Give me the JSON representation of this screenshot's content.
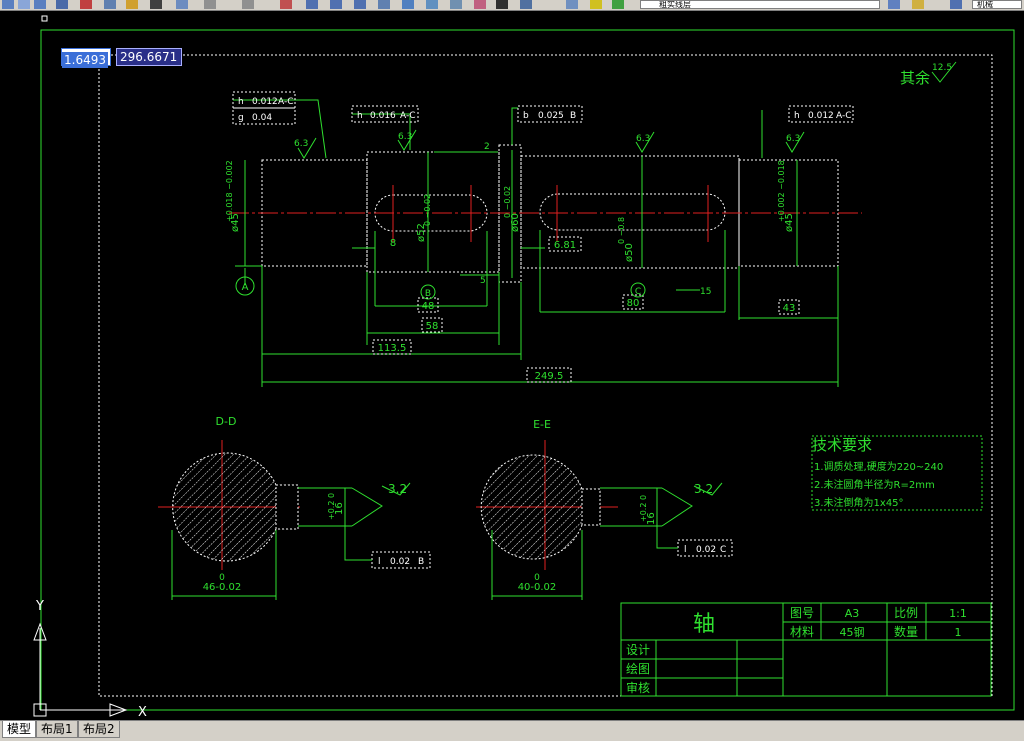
{
  "toolbar": {
    "layer_name": "粗实线层",
    "style_name": "机械"
  },
  "coordinate_input": {
    "x_value": "1.6493",
    "y_value": "296.6671"
  },
  "drawing": {
    "title": "轴",
    "surface_rest": "其余",
    "roughness_rest": "12.5",
    "roughness_6_3": "6.3",
    "roughness_3_2": "3.2",
    "datum_a": "A",
    "datum_b": "B",
    "datum_c": "C",
    "tol1_row1": [
      "h",
      "0.012",
      "A-C"
    ],
    "tol1_row2": [
      "g",
      "0.04"
    ],
    "tol2": [
      "h",
      "0.016",
      "A-C"
    ],
    "tol3": [
      "b",
      "0.025",
      "B"
    ],
    "tol4": [
      "h",
      "0.012",
      "A-C"
    ],
    "tol5": [
      "l",
      "0.02",
      "B"
    ],
    "tol6": [
      "l",
      "0.02",
      "C"
    ],
    "dims": {
      "d45_left": "ø45",
      "d45_left_tol": "+0.018 −0.002",
      "d52": "ø52",
      "d52_tol": "0 −0.02",
      "d60": "ø60",
      "d60_tol": "0 −0.02",
      "d50": "ø50",
      "d50_tol": "0 −0.8",
      "d45_right": "ø45",
      "d45_right_tol": "+0.002 −0.018",
      "w8": "8",
      "w6_81": "6.81",
      "l48": "48",
      "l58": "58",
      "l80": "80",
      "l43": "43",
      "l113_5": "113.5",
      "l249_5": "249.5",
      "d2": "2",
      "d5": "5",
      "d15": "15"
    },
    "section_d": "D-D",
    "section_e": "E-E",
    "sec_d_width": "46-0.02",
    "sec_d_width_top": "0",
    "sec_d_depth": "16",
    "sec_d_depth_tol": "+0.2 0",
    "sec_e_width": "40-0.02",
    "sec_e_width_top": "0",
    "sec_e_depth": "16",
    "sec_e_depth_tol": "+0.2 0",
    "tech_title": "技术要求",
    "tech_items": [
      "1.调质处理,硬度为220~240",
      "2.未注圆角半径为R=2mm",
      "3.未注倒角为1x45°"
    ],
    "title_block": {
      "drawing_no_label": "图号",
      "drawing_no": "A3",
      "scale_label": "比例",
      "scale": "1:1",
      "material_label": "材料",
      "material": "45钢",
      "qty_label": "数量",
      "qty": "1",
      "design": "设计",
      "drawn": "绘图",
      "check": "审核"
    }
  },
  "ucs": {
    "x": "X",
    "y": "Y"
  },
  "tabs": [
    {
      "label": "模型",
      "active": true
    },
    {
      "label": "布局1",
      "active": false
    },
    {
      "label": "布局2",
      "active": false
    }
  ],
  "colors": {
    "background": "#000000",
    "drawing_green": "#2fe02f",
    "centerline_red": "#e02020",
    "white": "#ffffff"
  }
}
